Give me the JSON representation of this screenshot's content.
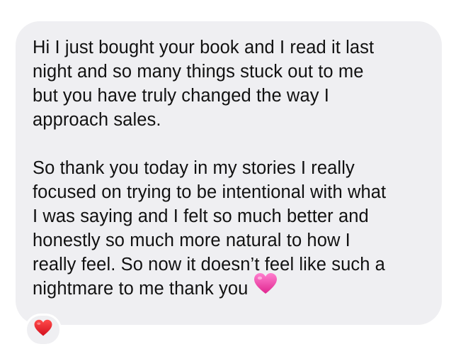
{
  "message": {
    "paragraphs": [
      {
        "lines": [
          "Hi I just bought your book and I read it last",
          "night and so many things stuck out to me",
          "but you have truly changed the way I",
          "approach sales."
        ]
      },
      {
        "lines": [
          "So thank you today in my stories I really",
          "focused on trying to be intentional with what",
          "I was saying and I felt so much better and",
          "honestly so much more natural to how I",
          "really feel. So now it doesn’t feel like such a",
          "nightmare to me thank you"
        ],
        "trailing_emoji": "pink-heart-icon"
      }
    ],
    "reaction": "red-heart-icon"
  },
  "colors": {
    "bubble_background": "#efeff2",
    "text": "#111111",
    "pink_heart": "#f03fa6",
    "red_heart": "#e8202a"
  }
}
